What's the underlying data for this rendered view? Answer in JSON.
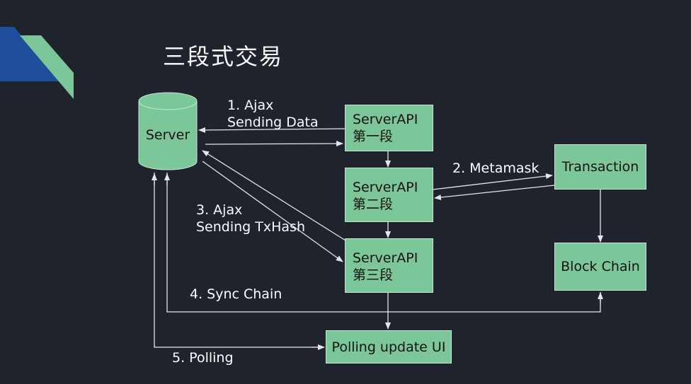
{
  "title": "三段式交易",
  "colors": {
    "background": "#1f232b",
    "box_fill": "#7cc79a",
    "box_border": "#c9e7d3",
    "arrow": "#e6e6e6",
    "deco_blue": "#1f4e9c",
    "deco_green": "#7cc79a"
  },
  "nodes": {
    "server": {
      "label": "Server"
    },
    "api1": {
      "line1": "ServerAPI",
      "line2": "第一段"
    },
    "api2": {
      "line1": "ServerAPI",
      "line2": "第二段"
    },
    "api3": {
      "line1": "ServerAPI",
      "line2": "第三段"
    },
    "transaction": {
      "label": "Transaction"
    },
    "blockchain": {
      "label": "Block Chain"
    },
    "polling_ui": {
      "label": "Polling update UI"
    }
  },
  "edge_labels": {
    "ajax_1": {
      "line1": "1. Ajax",
      "line2": "Sending Data"
    },
    "metamask_2": {
      "line1": "2. Metamask"
    },
    "ajax_3": {
      "line1": "3. Ajax",
      "line2": "Sending TxHash"
    },
    "sync_4": {
      "line1": "4. Sync Chain"
    },
    "polling_5": {
      "line1": "5. Polling"
    }
  }
}
